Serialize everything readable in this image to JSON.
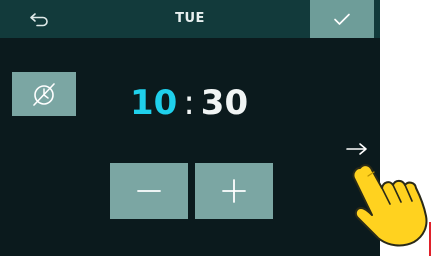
{
  "header": {
    "day": "TUE",
    "back_icon": "back-arrow-icon",
    "confirm_icon": "checkmark-icon"
  },
  "mode": {
    "icon": "timer-off-icon"
  },
  "time": {
    "hours": "10",
    "separator": ":",
    "minutes": "30"
  },
  "controls": {
    "decrease_icon": "minus-icon",
    "increase_icon": "plus-icon",
    "next_icon": "right-arrow-icon"
  },
  "annotation": {
    "pointer_icon": "pointing-hand-icon"
  },
  "colors": {
    "screen_bg": "#0b1a1d",
    "topbar_bg": "#123a3b",
    "button_bg": "#7ba6a3",
    "confirm_bg": "#6e9d99",
    "hours_accent": "#1fd0ec",
    "text": "#f0f4f4",
    "hand_fill": "#ffd21f",
    "pointer_line": "#e0202a"
  }
}
